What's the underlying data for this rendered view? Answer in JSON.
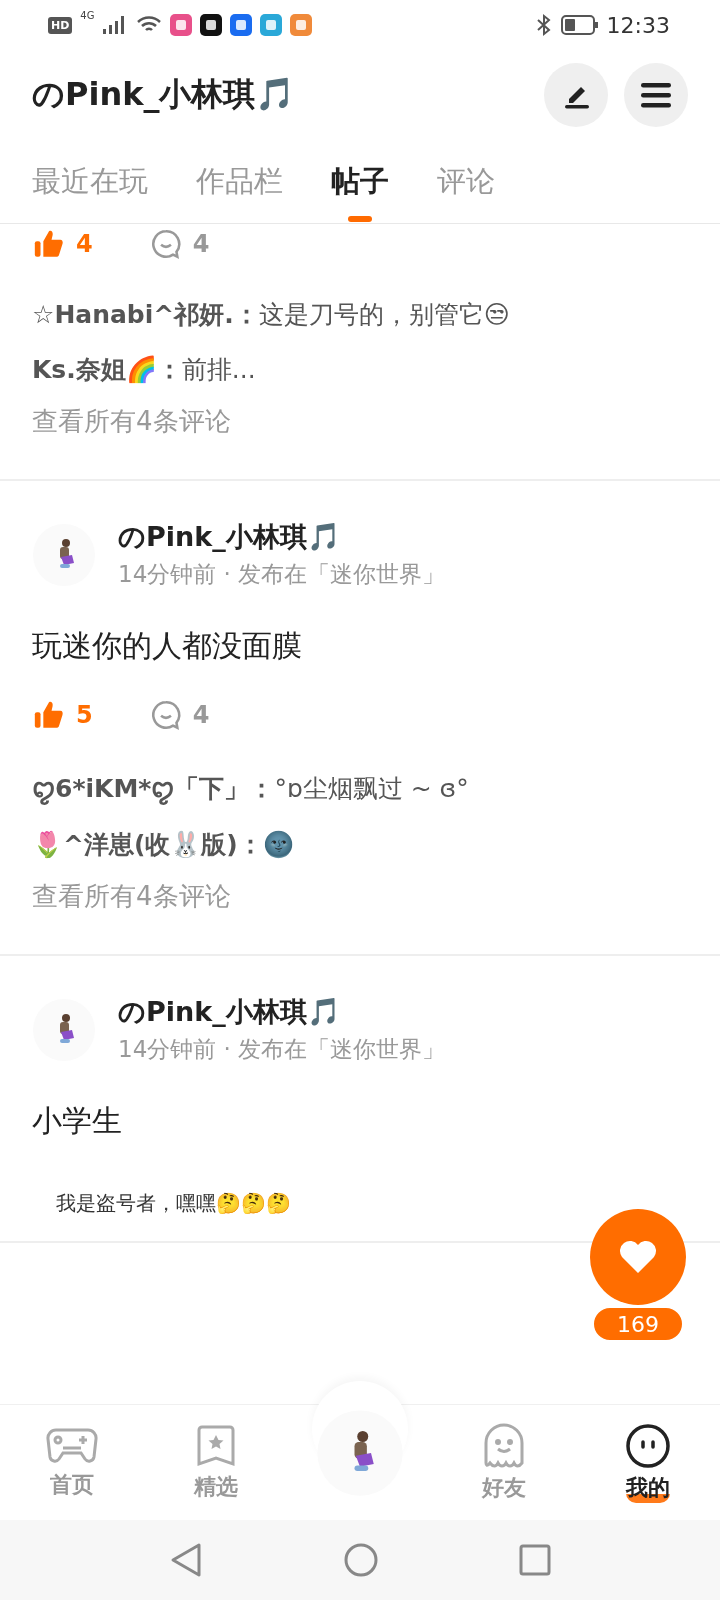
{
  "status_bar": {
    "hd": "HD",
    "network": "4G",
    "time": "12:33"
  },
  "header": {
    "title": "のPink_小林琪🎵"
  },
  "tabs": [
    {
      "label": "最近在玩",
      "selected": false
    },
    {
      "label": "作品栏",
      "selected": false
    },
    {
      "label": "帖子",
      "selected": true
    },
    {
      "label": "评论",
      "selected": false
    }
  ],
  "posts": [
    {
      "likes": "4",
      "liked": true,
      "comment_count": "4",
      "comments": [
        "**☆Hanabi^祁妍.：**这是刀号的，别管它😒",
        "**Ks.奈姐🌈：**前排..."
      ],
      "view_all": "查看所有4条评论"
    },
    {
      "author": "のPink_小林琪🎵",
      "meta": "14分钟前 · 发布在「迷你世界」",
      "text": "玩迷你的人都没面膜",
      "likes": "5",
      "liked": true,
      "comment_count": "4",
      "comments": [
        "**ꨄ6*iKM*ꨄ「下」：**°ɒ尘烟飘过 ~ ɞ°",
        "**🌷^洋崽(收🐰版)：**🌚"
      ],
      "view_all": "查看所有4条评论"
    },
    {
      "author": "のPink_小林琪🎵",
      "meta": "14分钟前 · 发布在「迷你世界」",
      "text": "小学生",
      "note": "我是盗号者，嘿嘿🤔🤔🤔"
    }
  ],
  "floating_like": {
    "count": "169"
  },
  "bottom_nav": [
    {
      "kind": "gamepad",
      "label": "首页",
      "selected": false
    },
    {
      "kind": "star",
      "label": "精选",
      "selected": false
    },
    {
      "kind": "avatar",
      "selected": false
    },
    {
      "kind": "ghost",
      "label": "好友",
      "selected": false
    },
    {
      "kind": "face",
      "label": "我的",
      "selected": true
    }
  ]
}
